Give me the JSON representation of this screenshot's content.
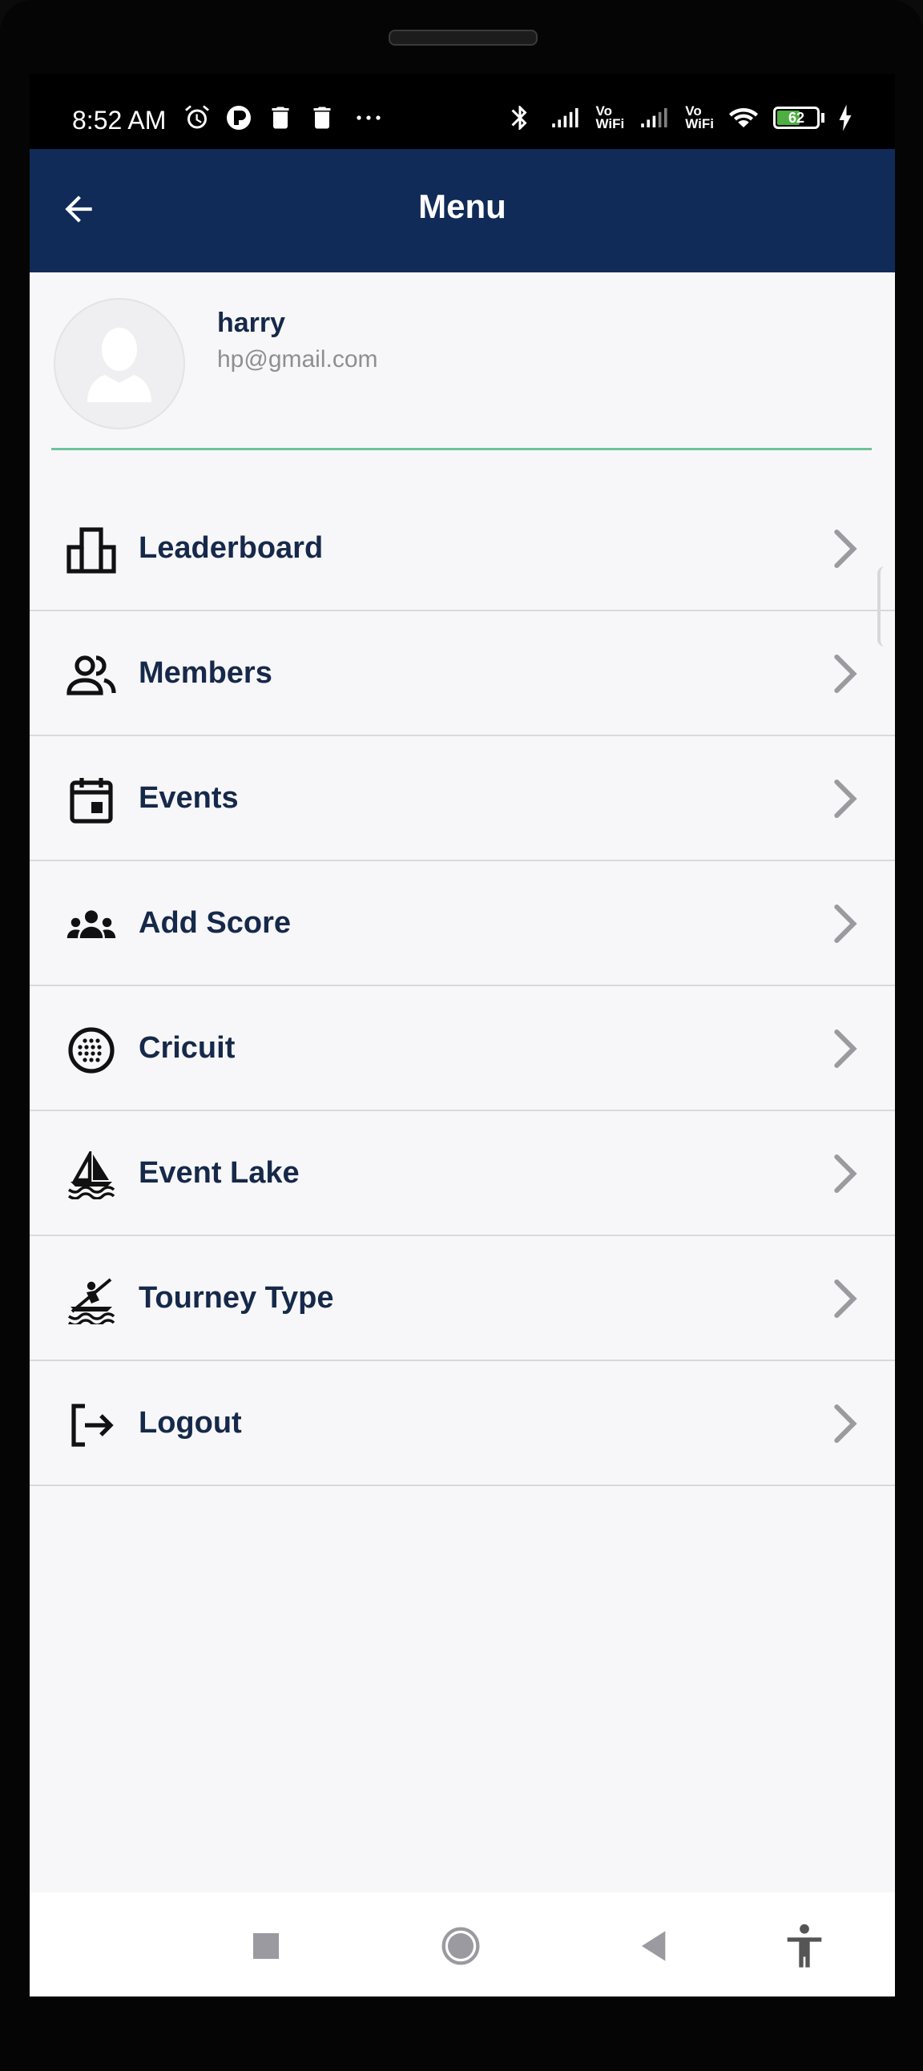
{
  "status_bar": {
    "time": "8:52 AM",
    "left_icons": [
      "alarm-icon",
      "app-notification-icon",
      "trash-icon",
      "trash-icon",
      "more-dots-icon"
    ],
    "right_icons": [
      "bluetooth-icon",
      "signal-icon",
      "vowifi-icon",
      "signal-icon",
      "vowifi-icon",
      "wifi-icon",
      "battery-icon",
      "charging-icon"
    ],
    "vowifi_label_top": "Vo",
    "vowifi_label_bottom": "WiFi",
    "battery_level": "62",
    "battery_fraction": 0.62,
    "battery_color": "#4caf3f"
  },
  "header": {
    "title": "Menu",
    "back_icon": "arrow-left-icon",
    "background": "#102b57"
  },
  "profile": {
    "name": "harry",
    "email": "hp@gmail.com",
    "avatar_icon": "user-placeholder-icon",
    "divider_color": "#6cc39a"
  },
  "menu": {
    "items": [
      {
        "label": "Leaderboard",
        "icon": "leaderboard-icon"
      },
      {
        "label": "Members",
        "icon": "members-icon"
      },
      {
        "label": "Events",
        "icon": "calendar-icon"
      },
      {
        "label": "Add Score",
        "icon": "group-icon"
      },
      {
        "label": "Cricuit",
        "icon": "circuit-icon"
      },
      {
        "label": "Event Lake",
        "icon": "sailboat-icon"
      },
      {
        "label": "Tourney Type",
        "icon": "kayak-icon"
      },
      {
        "label": "Logout",
        "icon": "logout-icon"
      }
    ],
    "chevron_icon": "chevron-right-icon"
  },
  "nav_bar": {
    "buttons": [
      "recents-square-icon",
      "home-circle-icon",
      "back-triangle-icon",
      "accessibility-icon"
    ]
  }
}
